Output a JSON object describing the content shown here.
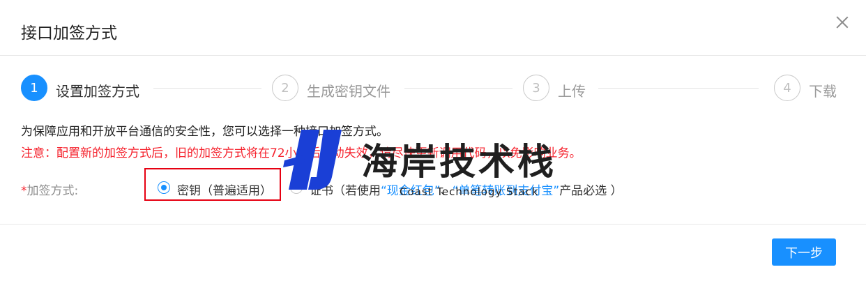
{
  "dialog": {
    "title": "接口加签方式"
  },
  "steps": [
    {
      "number": "1",
      "label": "设置加签方式",
      "active": true
    },
    {
      "number": "2",
      "label": "生成密钥文件",
      "active": false
    },
    {
      "number": "3",
      "label": "上传",
      "active": false
    },
    {
      "number": "4",
      "label": "下载",
      "active": false
    }
  ],
  "content": {
    "description": "为保障应用和开放平台通信的安全性，您可以选择一种接口加签方式。",
    "warning": "注意：配置新的加签方式后，旧的加签方式将在72小时后自动失效，请尽快更新调用代码，以免影响业务。"
  },
  "signing": {
    "required_mark": "*",
    "label": "加签方式:",
    "option_key": "密钥（普遍适用）",
    "option_cert_prefix": "证书（若使用",
    "option_cert_link1": "“现金红包”",
    "option_cert_sep": "、",
    "option_cert_link2": "“单笔转账到支付宝”",
    "option_cert_suffix": "产品必选 ）",
    "selected": "密钥"
  },
  "footer": {
    "next_label": "下一步"
  },
  "watermark": {
    "title": "海岸技术栈",
    "subtitle": "Coast Technology Stack"
  },
  "colors": {
    "primary": "#1890ff",
    "warning": "#f5222d",
    "highlight_box": "#e60012"
  }
}
